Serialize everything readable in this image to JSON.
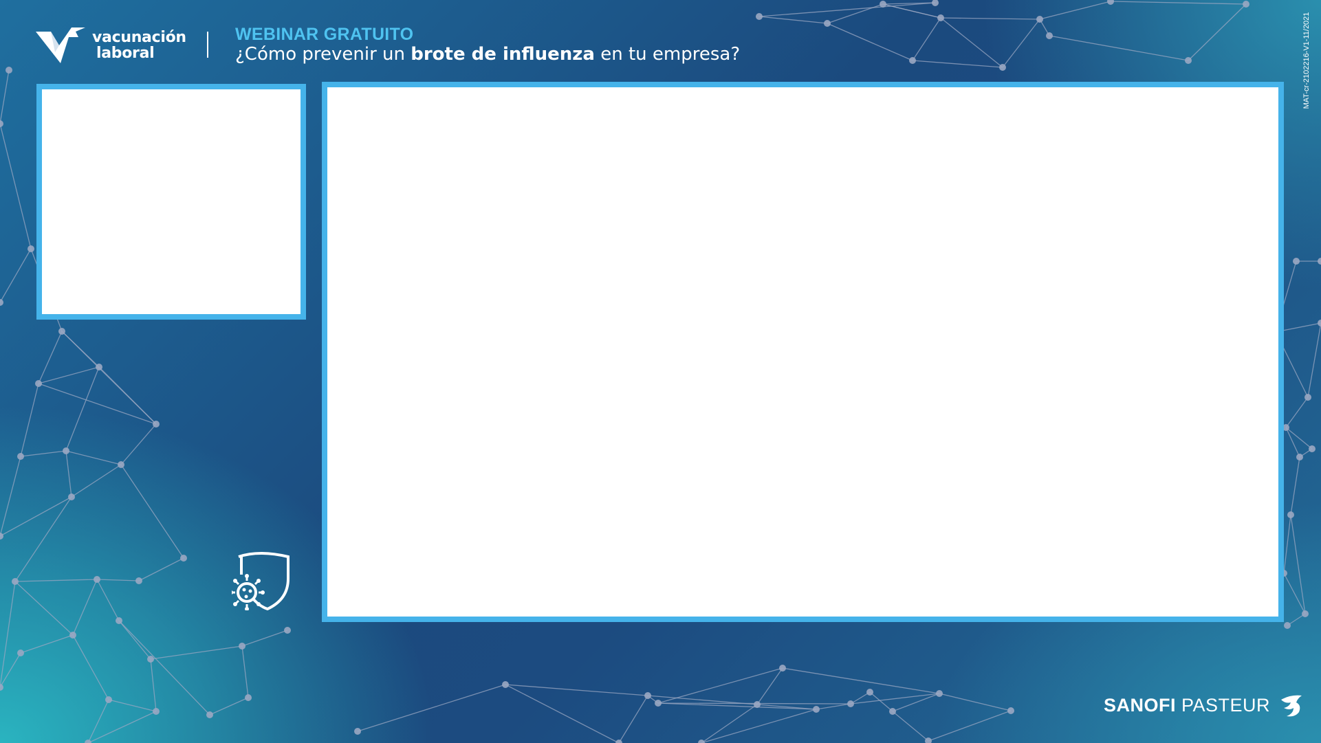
{
  "brand": {
    "logo_line1": "vacunación",
    "logo_line2": "laboral"
  },
  "header": {
    "kicker": "WEBINAR GRATUITO",
    "question_before": "¿Cómo prevenir un ",
    "question_bold": "brote de influenza",
    "question_after": " en tu empresa?"
  },
  "footer": {
    "sponsor_bold": "SANOFI",
    "sponsor_rest": " PASTEUR",
    "document_code": "MAT-cr-2102216-V1-11/2021"
  },
  "icons": [
    "logo-check-icon",
    "shield-virus-icon",
    "sanofi-bird-icon"
  ],
  "colors": {
    "accent": "#45b3ea",
    "kicker": "#4fc3f0",
    "background_dark": "#1b4a7e",
    "background_light": "#2ab4c0",
    "network": "#9aa7c2"
  }
}
